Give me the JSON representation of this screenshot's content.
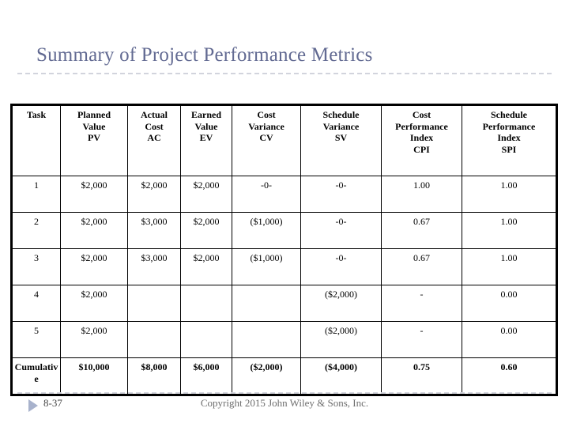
{
  "slide": {
    "title": "Summary of Project Performance Metrics",
    "title_color": "#626a92",
    "rule_color": "#d2d4dd"
  },
  "table": {
    "headers": [
      "Task",
      "Planned\nValue\nPV",
      "Actual\nCost\nAC",
      "Earned\nValue\nEV",
      "Cost\nVariance\nCV",
      "Schedule\nVariance\nSV",
      "Cost\nPerformance\nIndex\nCPI",
      "Schedule\nPerformance\nIndex\nSPI"
    ],
    "header_lines": {
      "task": [
        "Task"
      ],
      "pv": [
        "Planned",
        "Value",
        "PV"
      ],
      "ac": [
        "Actual",
        "Cost",
        "AC"
      ],
      "ev": [
        "Earned",
        "Value",
        "EV"
      ],
      "cv": [
        "Cost",
        "Variance",
        "CV"
      ],
      "sv": [
        "Schedule",
        "Variance",
        "SV"
      ],
      "cpi": [
        "Cost",
        "Performance",
        "Index",
        "CPI"
      ],
      "spi": [
        "Schedule",
        "Performance",
        "Index",
        "SPI"
      ]
    },
    "rows": [
      {
        "task": "1",
        "pv": "$2,000",
        "ac": "$2,000",
        "ev": "$2,000",
        "cv": "-0-",
        "sv": "-0-",
        "cpi": "1.00",
        "spi": "1.00",
        "bold": false
      },
      {
        "task": "2",
        "pv": "$2,000",
        "ac": "$3,000",
        "ev": "$2,000",
        "cv": "($1,000)",
        "sv": "-0-",
        "cpi": "0.67",
        "spi": "1.00",
        "bold": false
      },
      {
        "task": "3",
        "pv": "$2,000",
        "ac": "$3,000",
        "ev": "$2,000",
        "cv": "($1,000)",
        "sv": "-0-",
        "cpi": "0.67",
        "spi": "1.00",
        "bold": false
      },
      {
        "task": "4",
        "pv": "$2,000",
        "ac": "",
        "ev": "",
        "cv": "",
        "sv": "($2,000)",
        "cpi": "-",
        "spi": "0.00",
        "bold": false
      },
      {
        "task": "5",
        "pv": "$2,000",
        "ac": "",
        "ev": "",
        "cv": "",
        "sv": "($2,000)",
        "cpi": "-",
        "spi": "0.00",
        "bold": false
      },
      {
        "task": "Cumulative",
        "pv": "$10,000",
        "ac": "$8,000",
        "ev": "$6,000",
        "cv": "($2,000)",
        "sv": "($4,000)",
        "cpi": "0.75",
        "spi": "0.60",
        "bold": true
      }
    ]
  },
  "footer": {
    "slide_number": "8-37",
    "copyright": "Copyright 2015 John Wiley & Sons, Inc.",
    "marker_icon": "triangle-right-icon",
    "marker_color": "#a8b2cc"
  }
}
